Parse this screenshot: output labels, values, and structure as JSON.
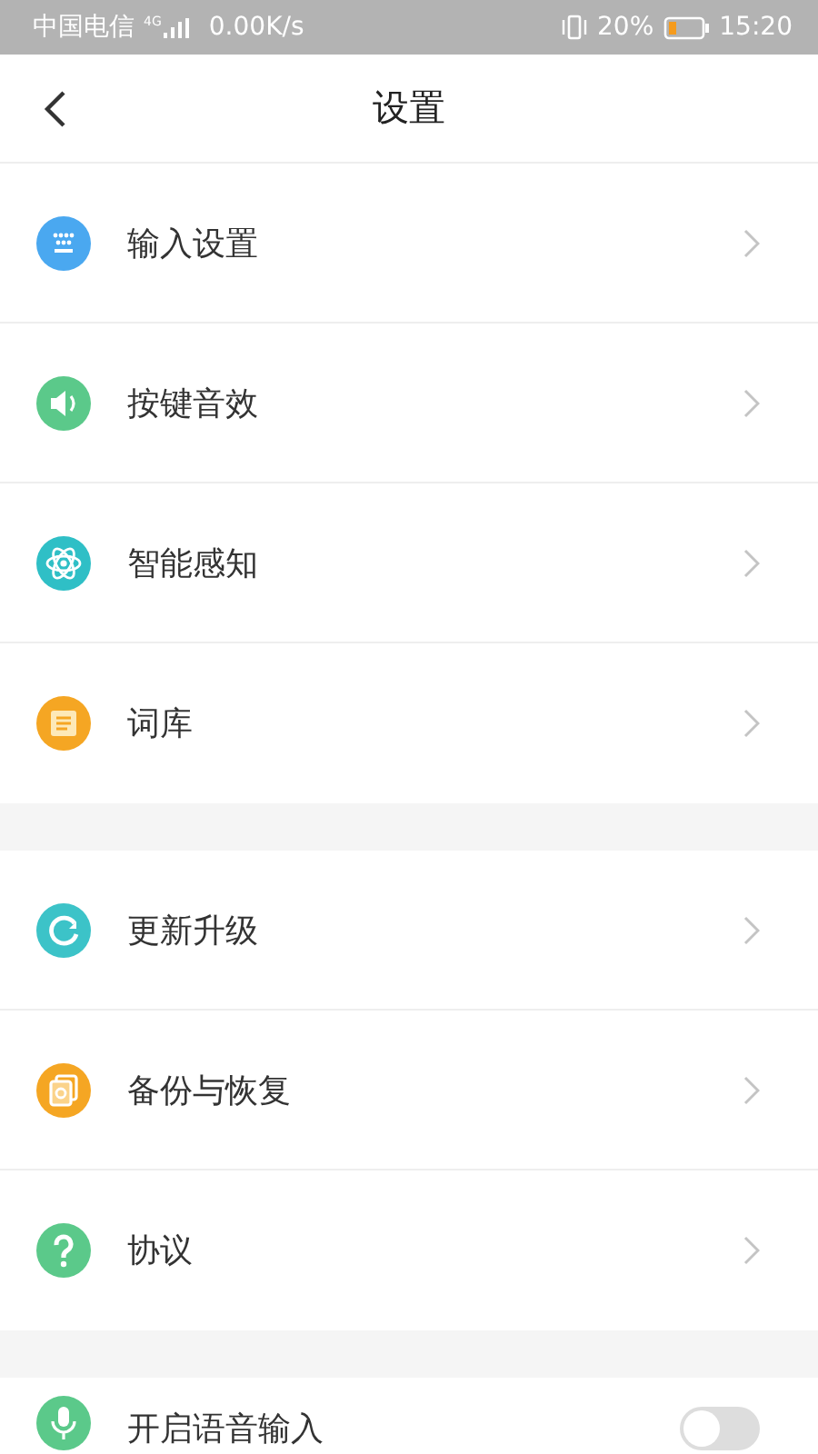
{
  "status_bar": {
    "carrier": "中国电信",
    "network": "4G",
    "speed": "0.00K/s",
    "battery": "20%",
    "time": "15:20"
  },
  "header": {
    "title": "设置"
  },
  "groups": [
    {
      "items": [
        {
          "kind": "link",
          "color": "#4aa8f0",
          "label": "输入设置"
        },
        {
          "kind": "link",
          "color": "#5bc98a",
          "label": "按键音效"
        },
        {
          "kind": "link",
          "color": "#2fbfc6",
          "label": "智能感知"
        },
        {
          "kind": "link",
          "color": "#f5a623",
          "label": "词库"
        }
      ]
    },
    {
      "items": [
        {
          "kind": "link",
          "color": "#3cc3c8",
          "label": "更新升级"
        },
        {
          "kind": "link",
          "color": "#f5a623",
          "label": "备份与恢复"
        },
        {
          "kind": "link",
          "color": "#5bc98a",
          "label": "协议"
        }
      ]
    },
    {
      "items": [
        {
          "kind": "toggle",
          "color": "#5bc98a",
          "label": "开启语音输入",
          "on": false
        }
      ]
    }
  ]
}
